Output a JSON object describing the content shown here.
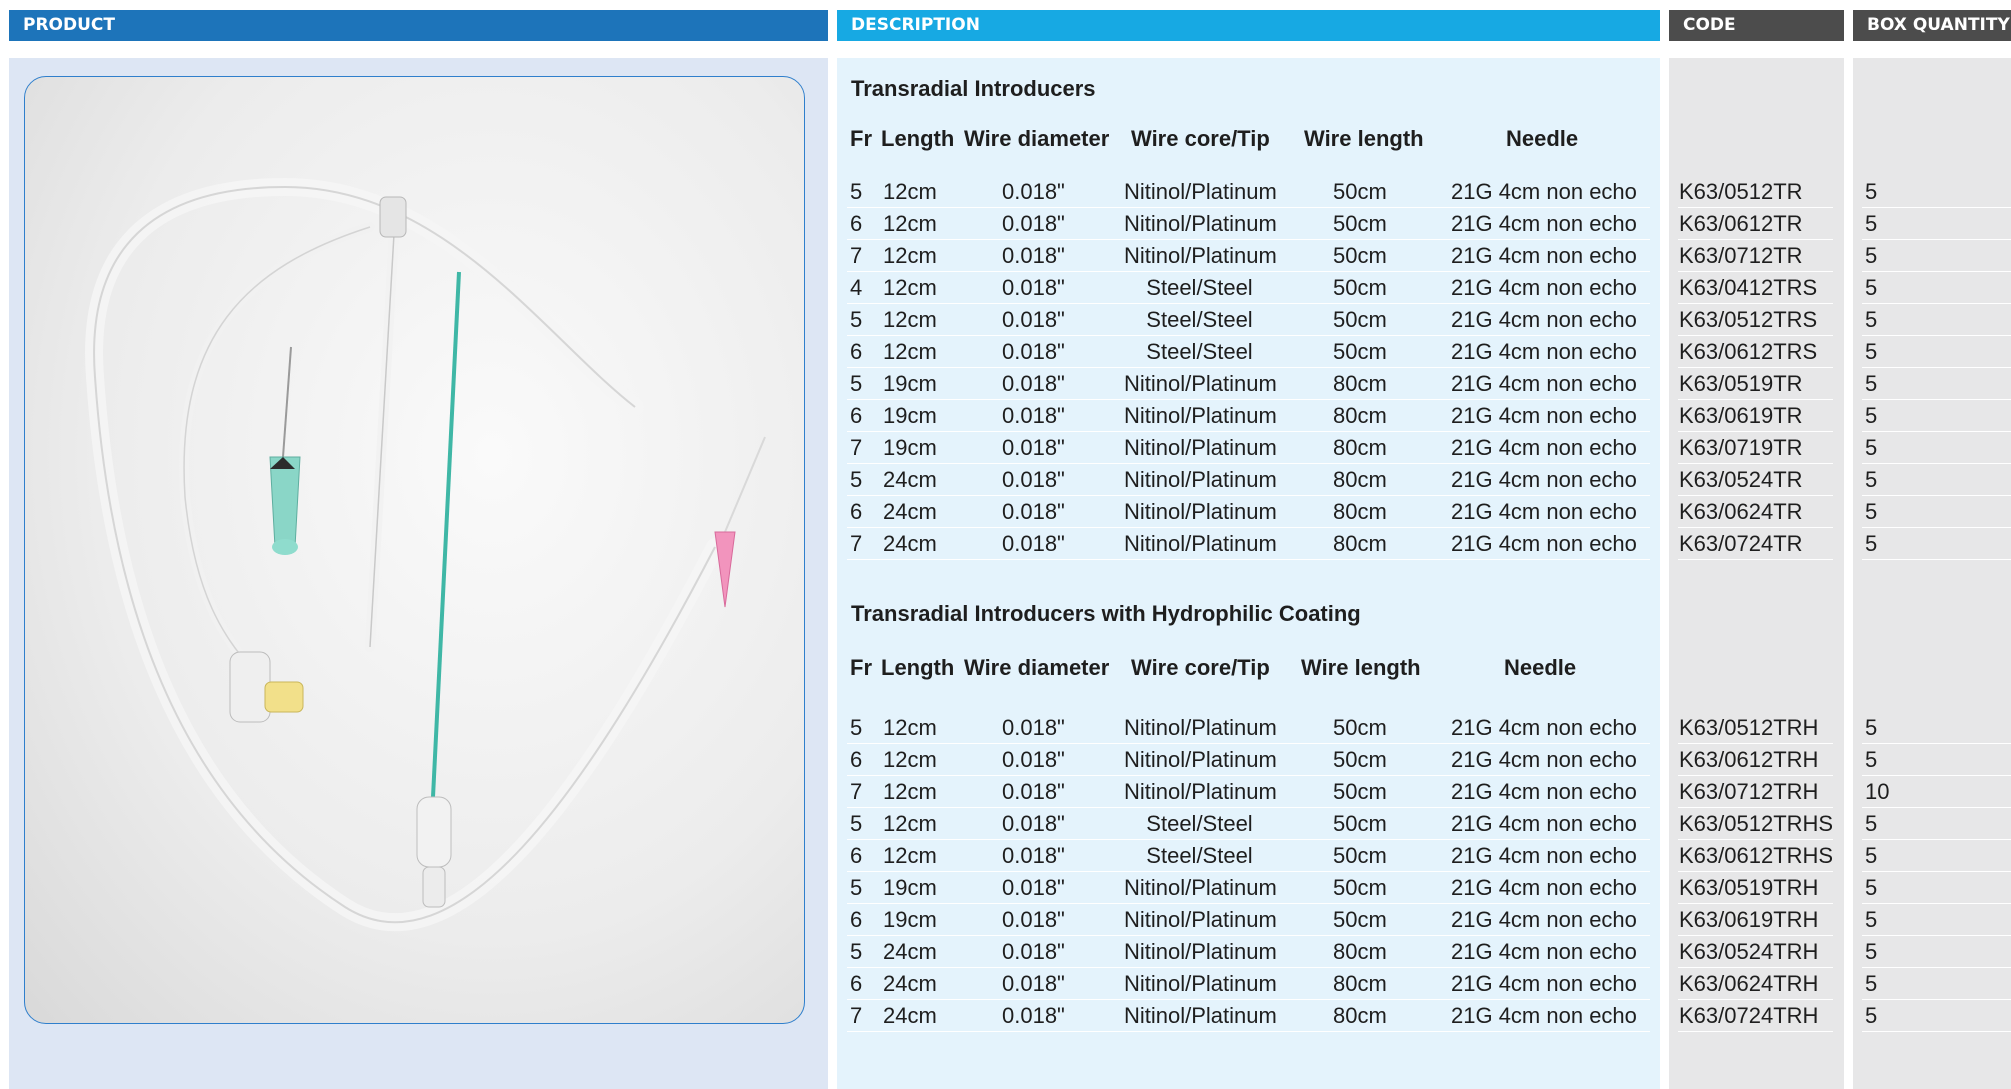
{
  "headers": {
    "product": "PRODUCT",
    "description": "DESCRIPTION",
    "code": "CODE",
    "box_quantity": "BOX QUANTITY"
  },
  "colors": {
    "product_header": "#1d74ba",
    "description_header": "#17a9e3",
    "code_header": "#4c4c4c",
    "product_panel": "#dde6f4",
    "description_panel": "#e4f3fc",
    "code_panel": "#e7e7e8",
    "photo_border": "#2f7fcc"
  },
  "photo": {
    "icon": "medical-introducer-kit-photo"
  },
  "columns": {
    "fr": "Fr",
    "length": "Length",
    "wire_diameter": "Wire diameter",
    "wire_core": "Wire core/Tip",
    "wire_length": "Wire length",
    "needle": "Needle"
  },
  "sections": [
    {
      "title": "Transradial Introducers",
      "rows": [
        {
          "fr": "5",
          "length": "12cm",
          "wire_diameter": "0.018\"",
          "wire_core": "Nitinol/Platinum",
          "wire_length": "50cm",
          "needle": "21G 4cm non echo",
          "code": "K63/0512TR",
          "box": "5"
        },
        {
          "fr": "6",
          "length": "12cm",
          "wire_diameter": "0.018\"",
          "wire_core": "Nitinol/Platinum",
          "wire_length": "50cm",
          "needle": "21G 4cm non echo",
          "code": "K63/0612TR",
          "box": "5"
        },
        {
          "fr": "7",
          "length": "12cm",
          "wire_diameter": "0.018\"",
          "wire_core": "Nitinol/Platinum",
          "wire_length": "50cm",
          "needle": "21G 4cm non echo",
          "code": "K63/0712TR",
          "box": "5"
        },
        {
          "fr": "4",
          "length": "12cm",
          "wire_diameter": "0.018\"",
          "wire_core": "Steel/Steel",
          "wire_length": "50cm",
          "needle": "21G 4cm non echo",
          "code": "K63/0412TRS",
          "box": "5"
        },
        {
          "fr": "5",
          "length": "12cm",
          "wire_diameter": "0.018\"",
          "wire_core": "Steel/Steel",
          "wire_length": "50cm",
          "needle": "21G 4cm non echo",
          "code": "K63/0512TRS",
          "box": "5"
        },
        {
          "fr": "6",
          "length": "12cm",
          "wire_diameter": "0.018\"",
          "wire_core": "Steel/Steel",
          "wire_length": "50cm",
          "needle": "21G 4cm non echo",
          "code": "K63/0612TRS",
          "box": "5"
        },
        {
          "fr": "5",
          "length": "19cm",
          "wire_diameter": "0.018\"",
          "wire_core": "Nitinol/Platinum",
          "wire_length": "80cm",
          "needle": "21G 4cm non echo",
          "code": "K63/0519TR",
          "box": "5"
        },
        {
          "fr": "6",
          "length": "19cm",
          "wire_diameter": "0.018\"",
          "wire_core": "Nitinol/Platinum",
          "wire_length": "80cm",
          "needle": "21G 4cm non echo",
          "code": "K63/0619TR",
          "box": "5"
        },
        {
          "fr": "7",
          "length": "19cm",
          "wire_diameter": "0.018\"",
          "wire_core": "Nitinol/Platinum",
          "wire_length": "80cm",
          "needle": "21G 4cm non echo",
          "code": "K63/0719TR",
          "box": "5"
        },
        {
          "fr": "5",
          "length": "24cm",
          "wire_diameter": "0.018\"",
          "wire_core": "Nitinol/Platinum",
          "wire_length": "80cm",
          "needle": "21G 4cm non echo",
          "code": "K63/0524TR",
          "box": "5"
        },
        {
          "fr": "6",
          "length": "24cm",
          "wire_diameter": "0.018\"",
          "wire_core": "Nitinol/Platinum",
          "wire_length": "80cm",
          "needle": "21G 4cm non echo",
          "code": "K63/0624TR",
          "box": "5"
        },
        {
          "fr": "7",
          "length": "24cm",
          "wire_diameter": "0.018\"",
          "wire_core": "Nitinol/Platinum",
          "wire_length": "80cm",
          "needle": "21G 4cm non echo",
          "code": "K63/0724TR",
          "box": "5"
        }
      ]
    },
    {
      "title": "Transradial Introducers with Hydrophilic Coating",
      "rows": [
        {
          "fr": "5",
          "length": "12cm",
          "wire_diameter": "0.018\"",
          "wire_core": "Nitinol/Platinum",
          "wire_length": "50cm",
          "needle": "21G 4cm non echo",
          "code": "K63/0512TRH",
          "box": "5"
        },
        {
          "fr": "6",
          "length": "12cm",
          "wire_diameter": "0.018\"",
          "wire_core": "Nitinol/Platinum",
          "wire_length": "50cm",
          "needle": "21G 4cm non echo",
          "code": "K63/0612TRH",
          "box": "5"
        },
        {
          "fr": "7",
          "length": "12cm",
          "wire_diameter": "0.018\"",
          "wire_core": "Nitinol/Platinum",
          "wire_length": "50cm",
          "needle": "21G 4cm non echo",
          "code": "K63/0712TRH",
          "box": "10"
        },
        {
          "fr": "5",
          "length": "12cm",
          "wire_diameter": "0.018\"",
          "wire_core": "Steel/Steel",
          "wire_length": "50cm",
          "needle": "21G 4cm non echo",
          "code": "K63/0512TRHS",
          "box": "5"
        },
        {
          "fr": "6",
          "length": "12cm",
          "wire_diameter": "0.018\"",
          "wire_core": "Steel/Steel",
          "wire_length": "50cm",
          "needle": "21G 4cm non echo",
          "code": "K63/0612TRHS",
          "box": "5"
        },
        {
          "fr": "5",
          "length": "19cm",
          "wire_diameter": "0.018\"",
          "wire_core": "Nitinol/Platinum",
          "wire_length": "50cm",
          "needle": "21G 4cm non echo",
          "code": "K63/0519TRH",
          "box": "5"
        },
        {
          "fr": "6",
          "length": "19cm",
          "wire_diameter": "0.018\"",
          "wire_core": "Nitinol/Platinum",
          "wire_length": "50cm",
          "needle": "21G 4cm non echo",
          "code": "K63/0619TRH",
          "box": "5"
        },
        {
          "fr": "5",
          "length": "24cm",
          "wire_diameter": "0.018\"",
          "wire_core": "Nitinol/Platinum",
          "wire_length": "80cm",
          "needle": "21G 4cm non echo",
          "code": "K63/0524TRH",
          "box": "5"
        },
        {
          "fr": "6",
          "length": "24cm",
          "wire_diameter": "0.018\"",
          "wire_core": "Nitinol/Platinum",
          "wire_length": "80cm",
          "needle": "21G 4cm non echo",
          "code": "K63/0624TRH",
          "box": "5"
        },
        {
          "fr": "7",
          "length": "24cm",
          "wire_diameter": "0.018\"",
          "wire_core": "Nitinol/Platinum",
          "wire_length": "80cm",
          "needle": "21G 4cm non echo",
          "code": "K63/0724TRH",
          "box": "5"
        }
      ]
    }
  ]
}
